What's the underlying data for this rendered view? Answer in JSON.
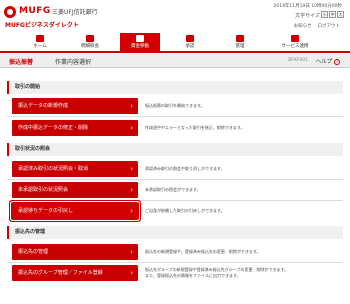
{
  "header": {
    "logo_text": "MUFG",
    "bank_name": "三菱UFJ信託銀行",
    "service_name": "MUFGビジネスダイレクト",
    "datetime": "2014年11月19日 10時00分00秒",
    "char_size_label": "文字サイズ",
    "size_small": "小",
    "size_medium": "中",
    "size_large": "大",
    "links": [
      "お知らせ",
      "ログアウト"
    ]
  },
  "nav": {
    "items": [
      {
        "label": "ホーム"
      },
      {
        "label": "明細照会"
      },
      {
        "label": "資金移動"
      },
      {
        "label": "承認"
      },
      {
        "label": "管理"
      },
      {
        "label": "サービス連携"
      }
    ]
  },
  "pagebar": {
    "title": "振込振替",
    "subtitle": "作業内容選択",
    "code": "BFKF001",
    "help": "ヘルプ"
  },
  "sections": [
    {
      "heading": "取引の開始",
      "rows": [
        {
          "button": "振込データの新規作成",
          "desc": "振込振替の取引を開始できます。"
        },
        {
          "button": "作成中振込データの修正・削除",
          "desc": "作成途中やエラーとなった取引を修正、削除できます。"
        }
      ]
    },
    {
      "heading": "取引状況の照会",
      "rows": [
        {
          "button": "承認済み取引の状況照会・取消",
          "desc": "承認済み取引の照会や取り消しができます。"
        },
        {
          "button": "未承認取引の状況照会",
          "desc": "未承認取引の照会ができます。"
        },
        {
          "button": "承認待ちデータの引戻し",
          "desc": "ご自身が依頼した取引の引戻しができます。"
        }
      ]
    },
    {
      "heading": "振込先の管理",
      "rows": [
        {
          "button": "振込先の管理",
          "desc": "振込先の新規登録や、登録済み振込先の変更、削除ができます。"
        },
        {
          "button": "振込先のグループ管理／ファイル登録",
          "desc_line1": "振込先グループの新規登録や登録済み振込先グループの変更、削除ができます。",
          "desc_line2": "また、登録振込先の情報をファイルに出力できます。"
        }
      ]
    }
  ],
  "colors": {
    "accent": "#d40000",
    "button": "#c80000"
  },
  "icons": {
    "chevron": "chevron-right-icon",
    "help": "question-icon"
  }
}
